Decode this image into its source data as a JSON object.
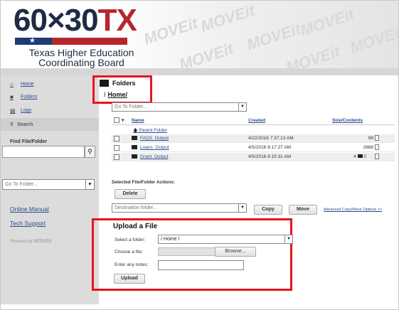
{
  "header": {
    "logo_main": "60×30",
    "logo_tx": "TX",
    "logo_line1": "Texas Higher Education",
    "logo_line2": "Coordinating Board",
    "watermark": "MOVEit"
  },
  "sidebar": {
    "items": [
      {
        "label": "Home",
        "icon": "home-icon"
      },
      {
        "label": "Folders",
        "icon": "folder-icon"
      },
      {
        "label": "Logs",
        "icon": "logs-icon"
      }
    ],
    "search_label": "Search",
    "find_label": "Find File/Folder",
    "goto_placeholder": "Go To Folder...",
    "links": [
      "Online Manual",
      "Tech Support"
    ],
    "powered_by": "Powered by",
    "powered_brand": "MOVEit"
  },
  "main": {
    "title": "Folders",
    "breadcrumb_sep": "/",
    "breadcrumb": "Home/",
    "goto_placeholder": "Go To Folder...",
    "columns": {
      "name": "Name",
      "created": "Created",
      "size": "Size/Contents"
    },
    "parent_folder": "Parent Folder",
    "rows": [
      {
        "name": "FADS_Output",
        "created": "4/22/2016 7:37:13 AM",
        "size": "99"
      },
      {
        "name": "Loans_Output",
        "created": "4/5/2016 8:17:27 AM",
        "size": "2888"
      },
      {
        "name": "Grant_Output",
        "created": "4/5/2016 8:15:31 AM",
        "size": "4",
        "size2": "0"
      }
    ],
    "actions_label": "Selected File/Folder Actions:",
    "delete_label": "Delete",
    "destination_placeholder": "Destination folder...",
    "copy_label": "Copy",
    "move_label": "Move",
    "advanced_label": "Advanced Copy/Move Options >>"
  },
  "upload": {
    "title": "Upload a File",
    "select_folder_label": "Select a folder:",
    "select_folder_value": "/ Home /",
    "choose_file_label": "Choose a file:",
    "browse_label": "Browse...",
    "notes_label": "Enter any notes:",
    "upload_label": "Upload"
  },
  "colors": {
    "highlight": "#e8141d",
    "brand_red": "#b5272d",
    "brand_blue": "#1f3b73",
    "link": "#2b4a8a"
  }
}
